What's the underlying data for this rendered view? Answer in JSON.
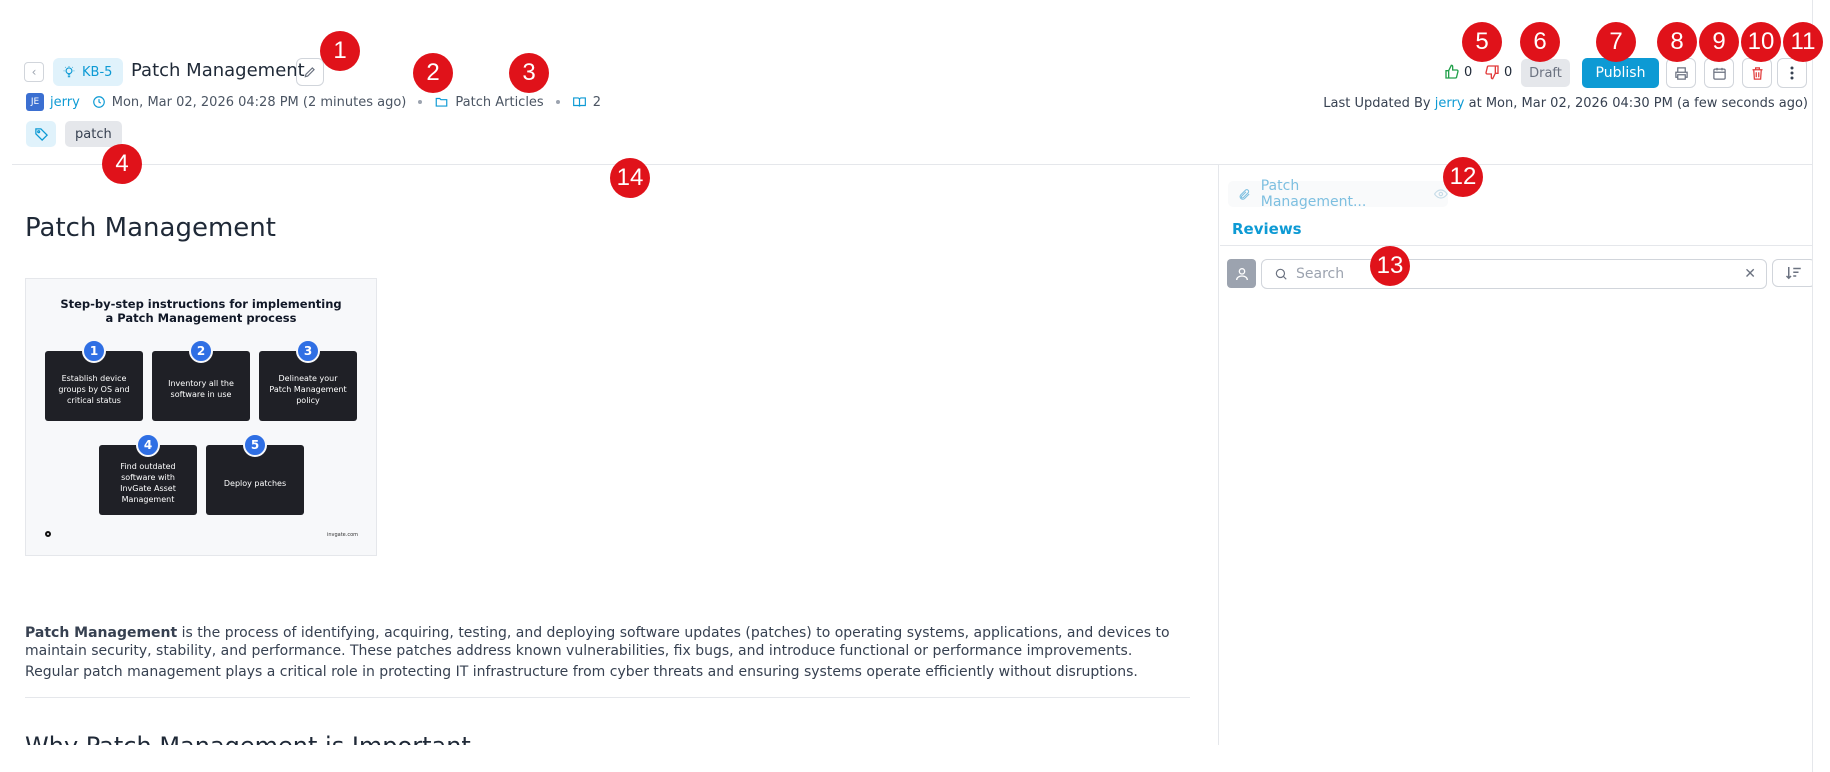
{
  "header": {
    "kb_id": "KB-5",
    "title": "Patch Management",
    "author_initials": "JE",
    "author": "jerry",
    "created": "Mon, Mar 02, 2026 04:28 PM (2 minutes ago)",
    "category": "Patch Articles",
    "views": "2",
    "tag": "patch"
  },
  "actions": {
    "likes": "0",
    "dislikes": "0",
    "status": "Draft",
    "publish_label": "Publish",
    "updated_prefix": "Last Updated By",
    "updated_user": "jerry",
    "updated_suffix": "at Mon, Mar 02, 2026 04:30 PM (a few seconds ago)"
  },
  "article": {
    "title": "Patch Management",
    "figure": {
      "title_line1": "Step-by-step instructions for implementing",
      "title_line2": "a Patch Management process",
      "steps": [
        {
          "num": "1",
          "text": "Establish device groups by OS and critical status"
        },
        {
          "num": "2",
          "text": "Inventory all the software in use"
        },
        {
          "num": "3",
          "text": "Delineate your Patch Management policy"
        },
        {
          "num": "4",
          "text": "Find outdated software with InvGate Asset Management"
        },
        {
          "num": "5",
          "text": "Deploy patches"
        }
      ],
      "footer": "invgate.com"
    },
    "para1_bold": "Patch Management",
    "para1_rest": " is the process of identifying, acquiring, testing, and deploying software updates (patches) to operating systems, applications, and devices to maintain security, stability, and performance. These patches address known vulnerabilities, fix bugs, and introduce functional or performance improvements.",
    "para2": "Regular patch management plays a critical role in protecting IT infrastructure from cyber threats and ensuring systems operate efficiently without disruptions.",
    "next_heading": "Why Patch Management is Important"
  },
  "side_panel": {
    "attachment": "Patch Management...",
    "tab_label": "Reviews",
    "search_placeholder": "Search"
  },
  "markers": [
    "1",
    "2",
    "3",
    "4",
    "5",
    "6",
    "7",
    "8",
    "9",
    "10",
    "11",
    "12",
    "13",
    "14"
  ],
  "colors": {
    "accent": "#0d9ad4",
    "marker": "#e0121a",
    "like": "#22a04b",
    "dislike": "#e23b3b",
    "delete": "#e23b3b"
  }
}
